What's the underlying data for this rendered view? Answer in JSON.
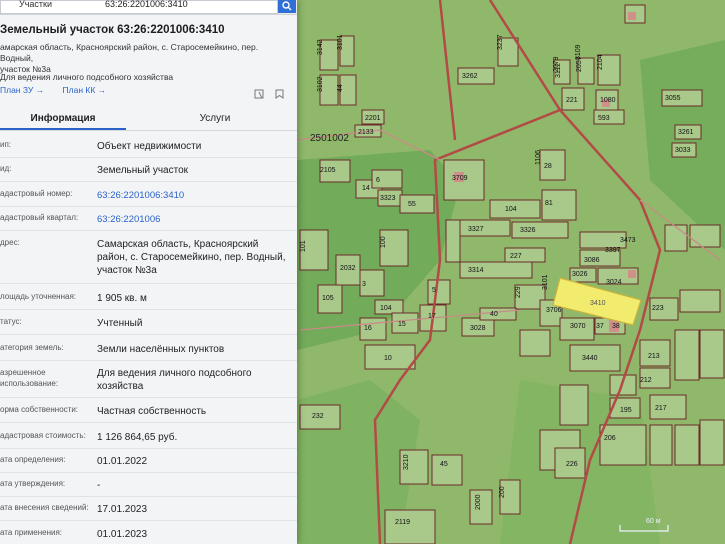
{
  "search": {
    "label": "Участки",
    "value": "63:26:2201006:3410"
  },
  "parcel": {
    "title": "Земельный участок 63:26:2201006:3410",
    "address_lines": [
      "амарская область, Красноярский район, с. Старосемейкино, пер. Водный,",
      "участок №3а"
    ],
    "purpose": "Для ведения личного подсобного хозяйства"
  },
  "links": {
    "plan_zu": "План ЗУ →",
    "plan_kk": "План КК →"
  },
  "tabs": [
    {
      "label": "Информация"
    },
    {
      "label": "Услуги"
    }
  ],
  "rows": [
    {
      "key": "ип:",
      "value": "Объект недвижимости"
    },
    {
      "key": "ид:",
      "value": "Земельный участок"
    },
    {
      "key": "адастровый номер:",
      "value": "63:26:2201006:3410"
    },
    {
      "key": "адастровый квартал:",
      "value": "63:26:2201006"
    },
    {
      "key": "дрес:",
      "value": "Самарская область, Красноярский район, с. Старосемейкино, пер. Водный, участок №3а"
    },
    {
      "key": "лощадь уточненная:",
      "value": "1 905 кв. м"
    },
    {
      "key": "татус:",
      "value": "Учтенный"
    },
    {
      "key": "атегория земель:",
      "value": "Земли населённых пунктов"
    },
    {
      "key": "азрешенное использование:",
      "value": "Для ведения личного подсобного хозяйства"
    },
    {
      "key": "орма собственности:",
      "value": "Частная собственность"
    },
    {
      "key": "адастровая стоимость:",
      "value": "1 126 864,65 руб."
    },
    {
      "key": "ата определения:",
      "value": "01.01.2022"
    },
    {
      "key": "ата утверждения:",
      "value": "-"
    },
    {
      "key": "ата внесения сведений:",
      "value": "17.01.2023"
    },
    {
      "key": "ата применения:",
      "value": "01.01.2023"
    }
  ],
  "map": {
    "quarter_label": "2501002",
    "scale_label": "60 м",
    "highlight_label": "3410",
    "labels": [
      "3142",
      "3101",
      "3102",
      "44",
      "2201",
      "2133",
      "3262",
      "3237",
      "2079",
      "2057",
      "2104",
      "2105",
      "14",
      "6",
      "3323",
      "55",
      "3709",
      "1106",
      "3112",
      "3109",
      "221",
      "1080",
      "593",
      "3055",
      "3261",
      "3033",
      "28",
      "104",
      "3327",
      "3326",
      "81",
      "3473",
      "3397",
      "3086",
      "3026",
      "3024",
      "227",
      "3314",
      "101",
      "100",
      "2032",
      "3",
      "105",
      "104",
      "15",
      "16",
      "17",
      "5",
      "229",
      "40",
      "3706",
      "3028",
      "3070",
      "37",
      "3440",
      "3101",
      "223",
      "213",
      "212",
      "195",
      "217",
      "206",
      "226",
      "38",
      "10",
      "232",
      "3210",
      "45",
      "2119",
      "2000",
      "200"
    ],
    "colors": {
      "parcel_fill": "#a9c98a",
      "parcel_stroke": "#6b2a2a",
      "highlight": "#f2ec6e",
      "road": "#c98b86",
      "building": "#d48a8a",
      "forest": "#6aa855"
    }
  }
}
